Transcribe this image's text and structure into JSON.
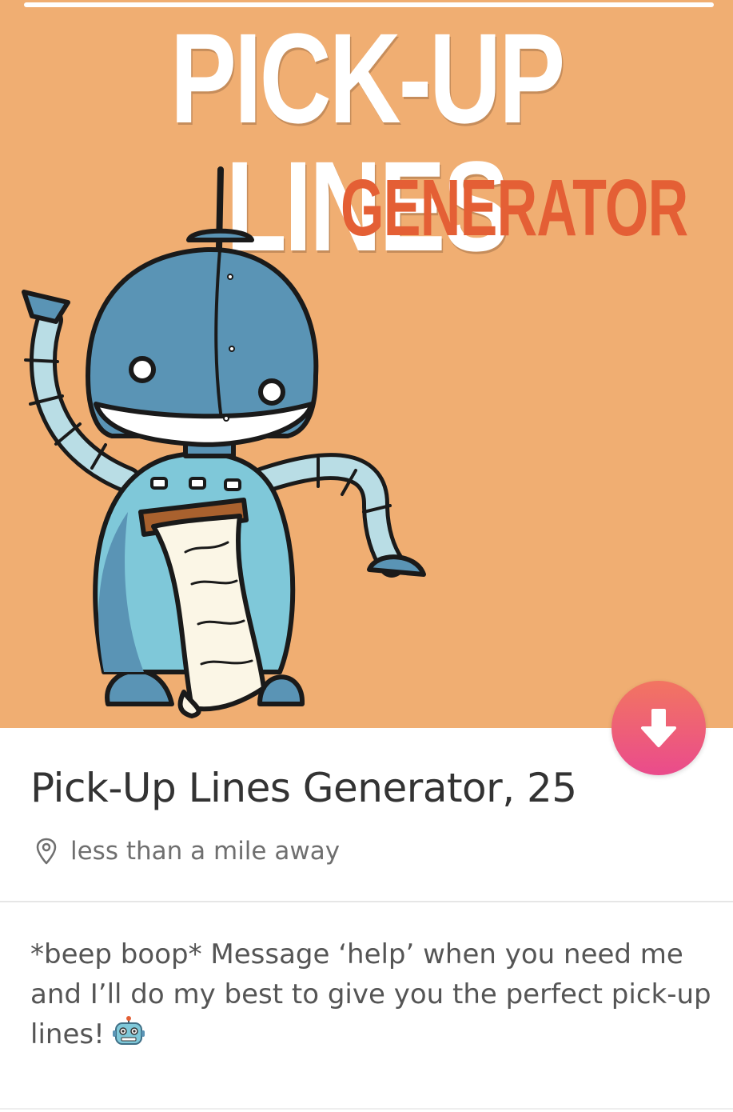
{
  "hero": {
    "title": "PICK-UP LINES",
    "subtitle": "GENERATOR",
    "background_color": "#f0ae72"
  },
  "profile": {
    "name_age": "Pick-Up Lines Generator, 25",
    "distance": "less than a mile away",
    "bio": "*beep boop* Message ‘help’ when you need me and I’ll do my best to give you the perfect pick-up lines!"
  },
  "icons": {
    "download": "arrow-down-icon",
    "location": "location-pin-icon",
    "bio_emoji": "robot-emoji-icon"
  },
  "colors": {
    "accent_gradient_top": "#f27561",
    "accent_gradient_bottom": "#ea4b8c",
    "title_red": "#e45f35"
  }
}
